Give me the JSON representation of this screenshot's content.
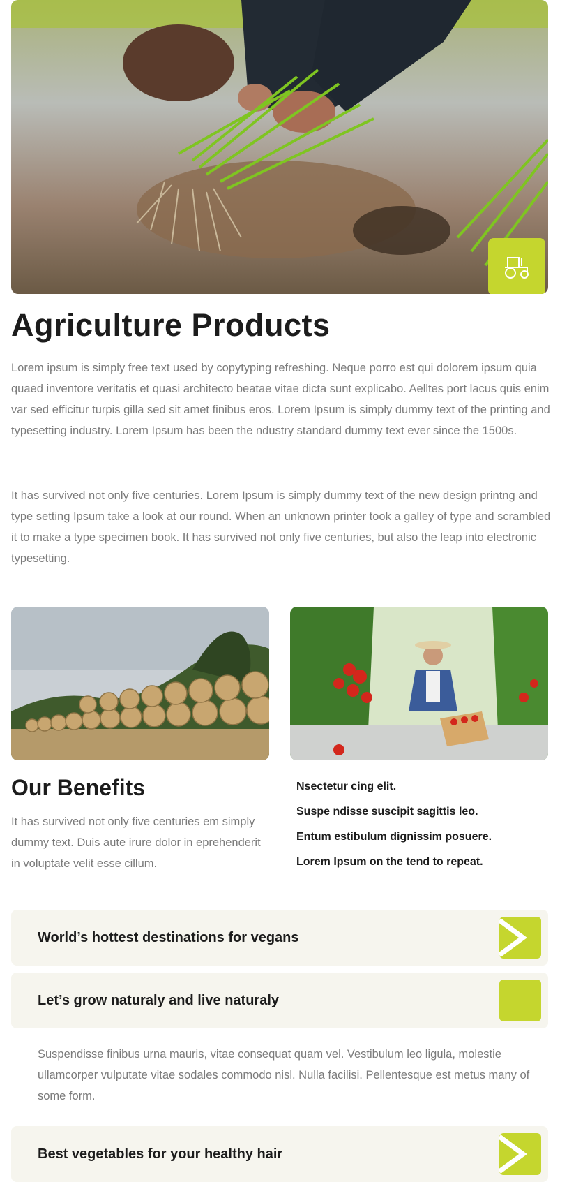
{
  "hero": {
    "image": "rice-planting-photo",
    "badge_icon": "tractor-icon",
    "accent_color": "#c5d62e"
  },
  "title": "Agriculture Products",
  "paragraphs": [
    "Lorem ipsum is simply free text used by copytyping refreshing. Neque porro est qui dolorem ipsum quia quaed inventore veritatis et quasi architecto beatae vitae dicta sunt explicabo. Aelltes port lacus quis enim var sed efficitur turpis gilla sed sit amet finibus eros. Lorem Ipsum is simply dummy text of the printing and typesetting industry. Lorem Ipsum has been the ndustry standard dummy text ever since the 1500s.",
    "It has survived not only five centuries. Lorem Ipsum is simply dummy text of the new design printng and type setting Ipsum take a look at our round. When an unknown printer took a galley of type and scrambled it to make a type specimen book. It has survived not only five centuries, but also the leap into electronic typesetting."
  ],
  "images": {
    "left": "hay-bales-photo",
    "right": "tomato-farmer-photo"
  },
  "benefits": {
    "title": "Our Benefits",
    "text": "It has survived not only five centuries em simply dummy text. Duis aute irure dolor in eprehenderit in voluptate velit esse cillum.",
    "items": [
      "Nsectetur cing elit.",
      "Suspe ndisse suscipit sagittis leo.",
      "Entum estibulum dignissim posuere.",
      "Lorem Ipsum on the tend to repeat."
    ]
  },
  "accordion": [
    {
      "title": "World’s hottest destinations for vegans",
      "icon": "chevron-right-icon",
      "expanded": false
    },
    {
      "title": "Let’s grow naturaly and live naturaly",
      "icon": "collapse-icon",
      "expanded": true,
      "body": "Suspendisse finibus urna mauris, vitae consequat quam vel. Vestibulum leo ligula, molestie ullamcorper vulputate vitae sodales commodo nisl. Nulla facilisi. Pellentesque est metus many of some form."
    },
    {
      "title": "Best vegetables for your healthy hair",
      "icon": "chevron-right-icon",
      "expanded": false
    }
  ]
}
